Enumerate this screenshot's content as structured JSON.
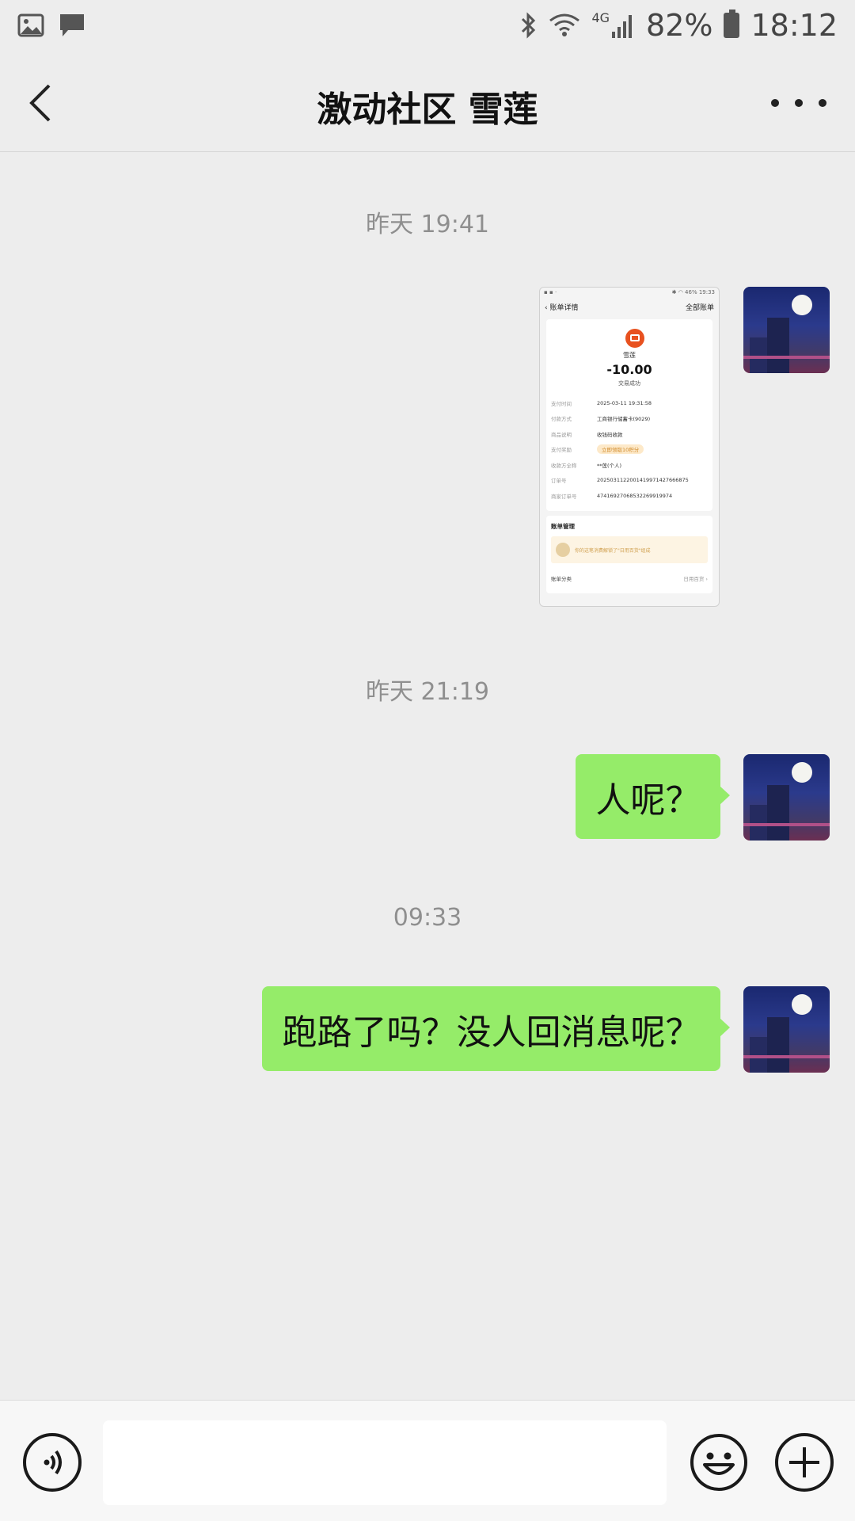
{
  "status_bar": {
    "battery": "82%",
    "time": "18:12",
    "network": "4G",
    "icons": [
      "gallery-icon",
      "message-icon",
      "bluetooth-icon",
      "wifi-icon",
      "signal-icon",
      "battery-icon"
    ]
  },
  "header": {
    "title": "激动社区 雪莲",
    "back_icon": "back-arrow-icon",
    "more_icon": "more-icon"
  },
  "messages": [
    {
      "timestamp": "昨天 19:41",
      "type": "image",
      "sender": "self",
      "image": {
        "header_title": "账单详情",
        "header_right": "全部账单",
        "merchant": "雪莲",
        "amount": "-10.00",
        "status": "交易成功",
        "rows": [
          {
            "key": "支付时间",
            "value": "2025-03-11 19:31:58"
          },
          {
            "key": "付款方式",
            "value": "工商银行储蓄卡(9029)"
          },
          {
            "key": "商品说明",
            "value": "收钱码收款"
          },
          {
            "key": "支付奖励",
            "value": "立即领取10积分"
          },
          {
            "key": "收款方全称",
            "value": "**莲(个人)"
          },
          {
            "key": "订单号",
            "value": "20250311220014199714276668​75"
          },
          {
            "key": "商家订单号",
            "value": "47416927068532269919974"
          }
        ],
        "section_title": "账单管理",
        "banner_text": "你的这笔消费解锁了\"日用百货\"组成",
        "category_label": "账单分类",
        "category_value": "日用百货"
      }
    },
    {
      "timestamp": "昨天 21:19",
      "type": "text",
      "sender": "self",
      "text": "人呢？"
    },
    {
      "timestamp": "09:33",
      "type": "text",
      "sender": "self",
      "text": "跑路了吗？没人回消息呢？"
    }
  ],
  "input_bar": {
    "value": "",
    "placeholder": "",
    "voice_icon": "voice-icon",
    "emoji_icon": "emoji-icon",
    "plus_icon": "plus-icon"
  },
  "colors": {
    "background": "#ededed",
    "bubble_self": "#95ec69",
    "timestamp": "#8f8f8f",
    "accent_logo": "#e8511f"
  }
}
